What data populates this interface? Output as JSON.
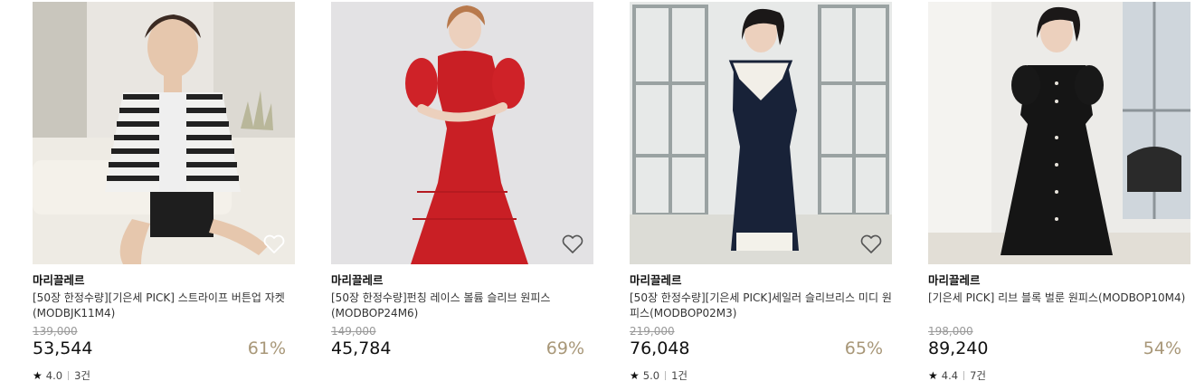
{
  "products": [
    {
      "brand": "마리끌레르",
      "title": "[50장 한정수량][기은세 PICK] 스트라이프 버튼업 자켓(MODBJK11M4)",
      "original_price": "139,000",
      "price": "53,544",
      "discount": "61%",
      "rating": "4.0",
      "reviews": "3건"
    },
    {
      "brand": "마리끌레르",
      "title": "[50장 한정수량]펀칭 레이스 볼륨 슬리브 원피스(MODBOP24M6)",
      "original_price": "149,000",
      "price": "45,784",
      "discount": "69%",
      "rating": null,
      "reviews": null
    },
    {
      "brand": "마리끌레르",
      "title": "[50장 한정수량][기은세 PICK]세일러 슬리브리스 미디 원피스(MODBOP02M3)",
      "original_price": "219,000",
      "price": "76,048",
      "discount": "65%",
      "rating": "5.0",
      "reviews": "1건"
    },
    {
      "brand": "마리끌레르",
      "title": "[기은세 PICK] 리브 블록 벌룬 원피스(MODBOP10M4)",
      "original_price": "198,000",
      "price": "89,240",
      "discount": "54%",
      "rating": "4.4",
      "reviews": "7건"
    }
  ],
  "icons": {
    "wishlist": "heart-outline-icon",
    "rating": "star-icon"
  },
  "colors": {
    "discount": "#a89778",
    "original_price": "#999999"
  }
}
